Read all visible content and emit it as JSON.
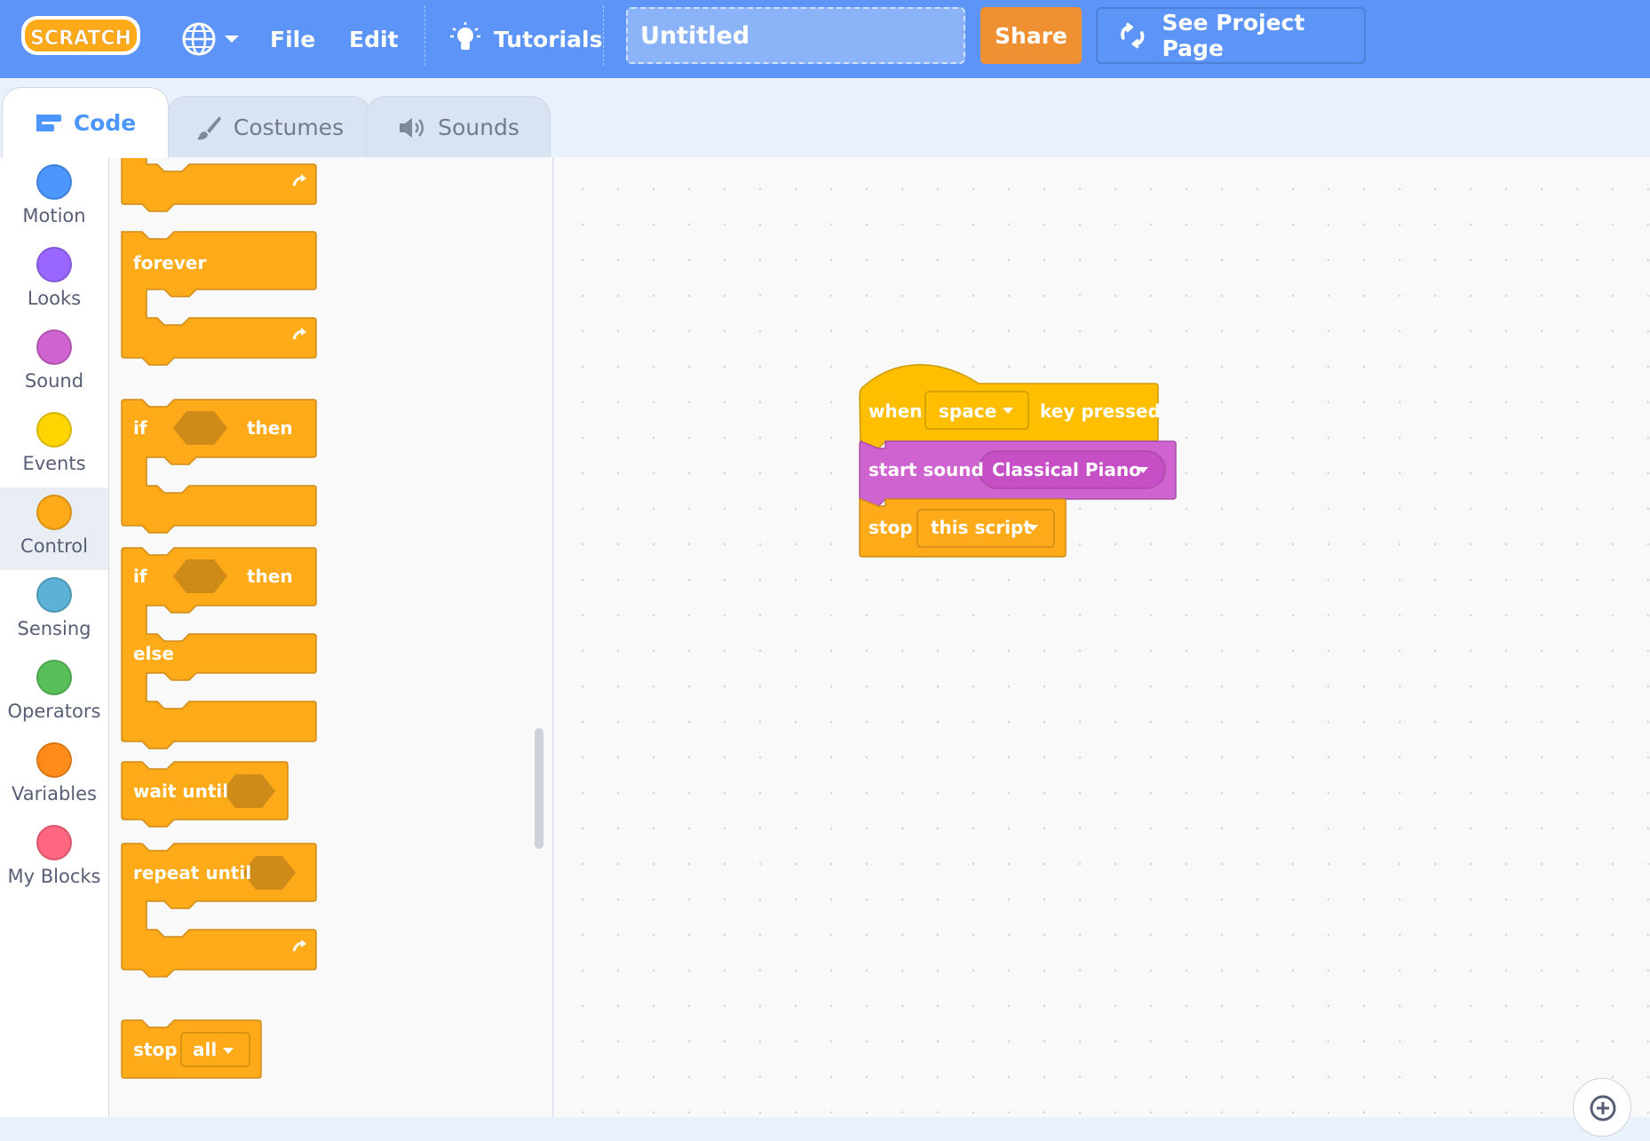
{
  "menubar": {
    "logo_text": "SCRATCH",
    "file_label": "File",
    "edit_label": "Edit",
    "tutorials_label": "Tutorials",
    "project_title": "Untitled",
    "share_label": "Share",
    "see_project_label": "See Project Page"
  },
  "tabs": [
    {
      "label": "Code",
      "active": true,
      "icon": "code-icon"
    },
    {
      "label": "Costumes",
      "active": false,
      "icon": "brush-icon"
    },
    {
      "label": "Sounds",
      "active": false,
      "icon": "speaker-icon"
    }
  ],
  "categories": [
    {
      "label": "Motion",
      "color": "#4c97ff"
    },
    {
      "label": "Looks",
      "color": "#9966ff"
    },
    {
      "label": "Sound",
      "color": "#cf63cf"
    },
    {
      "label": "Events",
      "color": "#ffd500"
    },
    {
      "label": "Control",
      "color": "#ffab19",
      "selected": true
    },
    {
      "label": "Sensing",
      "color": "#5cb1d6"
    },
    {
      "label": "Operators",
      "color": "#59c059"
    },
    {
      "label": "Variables",
      "color": "#ff8c1a"
    },
    {
      "label": "My Blocks",
      "color": "#ff6680"
    }
  ],
  "palette_blocks": {
    "forever": "forever",
    "if": "if",
    "then": "then",
    "else": "else",
    "wait_until": "wait until",
    "repeat_until": "repeat until",
    "stop": "stop",
    "stop_option": "all"
  },
  "script": {
    "hat_when": "when",
    "hat_key": "space",
    "hat_pressed": "key pressed",
    "sound_label": "start sound",
    "sound_name": "Classical Piano",
    "stop_label": "stop",
    "stop_option": "this script"
  },
  "colors": {
    "menubar": "#5c95f7",
    "control": "#ffab19",
    "events": "#ffbf00",
    "sound": "#cf63cf",
    "share": "#ef9133"
  }
}
